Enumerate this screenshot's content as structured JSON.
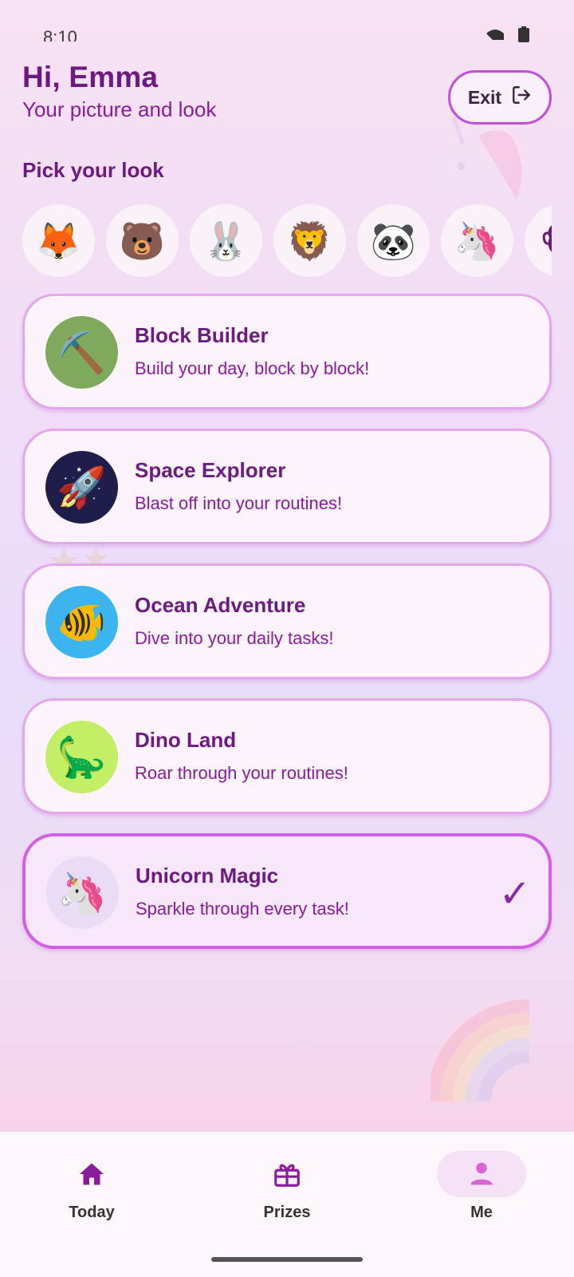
{
  "status_bar": {
    "time": "8:10",
    "icons": [
      "signal-icon",
      "battery-icon"
    ]
  },
  "header": {
    "greeting": "Hi, Emma",
    "subtitle": "Your picture and look",
    "exit_label": "Exit",
    "exit_icon": "logout-icon"
  },
  "avatars": {
    "section_label": "Pick your look",
    "items": [
      {
        "name": "fox",
        "emoji": "🦊"
      },
      {
        "name": "bear",
        "emoji": "🐻"
      },
      {
        "name": "rabbit",
        "emoji": "🐰"
      },
      {
        "name": "lion",
        "emoji": "🦁"
      },
      {
        "name": "panda",
        "emoji": "🐼"
      },
      {
        "name": "unicorn",
        "emoji": "🦄"
      },
      {
        "name": "monkey",
        "emoji": "🐵"
      }
    ]
  },
  "themes": [
    {
      "title": "Block Builder",
      "subtitle": "Build your day, block by block!",
      "emoji": "⛏️",
      "icon_bg": "#7faa5e",
      "selected": false
    },
    {
      "title": "Space Explorer",
      "subtitle": "Blast off into your routines!",
      "emoji": "🚀",
      "icon_bg": "#1f1e4a",
      "selected": false
    },
    {
      "title": "Ocean Adventure",
      "subtitle": "Dive into your daily tasks!",
      "emoji": "🐠",
      "icon_bg": "#3cb4ef",
      "selected": false
    },
    {
      "title": "Dino Land",
      "subtitle": "Roar through your routines!",
      "emoji": "🦕",
      "icon_bg": "#c2ef66",
      "selected": false
    },
    {
      "title": "Unicorn Magic",
      "subtitle": "Sparkle through every task!",
      "emoji": "🦄",
      "icon_bg": "#eadcf7",
      "selected": true,
      "check": "✓"
    }
  ],
  "nav": {
    "items": [
      {
        "label": "Today",
        "icon": "home-icon",
        "active": false
      },
      {
        "label": "Prizes",
        "icon": "gift-icon",
        "active": false
      },
      {
        "label": "Me",
        "icon": "person-icon",
        "active": true
      }
    ]
  },
  "colors": {
    "accent": "#6c1a80",
    "selected_border": "#d35fe4",
    "nav_icon": "#8a1c9c",
    "nav_icon_active": "#d865d6"
  }
}
